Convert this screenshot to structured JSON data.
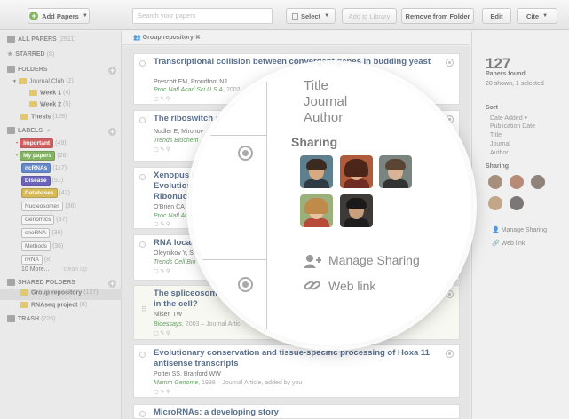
{
  "toolbar": {
    "add_papers": "Add Papers",
    "search_placeholder": "Search your papers",
    "select": "Select",
    "add_to_library": "Add to Library",
    "remove_from_folder": "Remove from Folder",
    "edit": "Edit",
    "cite": "Cite"
  },
  "sidebar": {
    "all_papers": {
      "label": "ALL PAPERS",
      "count": "(2911)"
    },
    "starred": {
      "label": "STARRED",
      "count": "(8)"
    },
    "folders": {
      "label": "FOLDERS"
    },
    "folder_items": [
      {
        "label": "Journal Club",
        "count": "(2)"
      },
      {
        "label": "Week 1",
        "count": "(4)"
      },
      {
        "label": "Week 2",
        "count": "(5)"
      },
      {
        "label": "Thesis",
        "count": "(128)"
      }
    ],
    "labels": {
      "label": "LABELS"
    },
    "label_items": [
      {
        "label": "Important",
        "count": "(49)",
        "color": "#c22b2b"
      },
      {
        "label": "My papers",
        "count": "(28)",
        "color": "#5a9a2f"
      },
      {
        "label": "ncRNAs",
        "count": "(117)",
        "color": "#2f62b8"
      },
      {
        "label": "Disease",
        "count": "(51)",
        "color": "#3b2fa8"
      },
      {
        "label": "Databases",
        "count": "(42)",
        "color": "#c9a220"
      },
      {
        "label": "Nucleosomes",
        "count": "(36)",
        "color": ""
      },
      {
        "label": "Genomics",
        "count": "(37)",
        "color": ""
      },
      {
        "label": "snoRNA",
        "count": "(36)",
        "color": ""
      },
      {
        "label": "Methods",
        "count": "(36)",
        "color": ""
      },
      {
        "label": "rRNA",
        "count": "(8)",
        "color": ""
      }
    ],
    "more": "10 More...",
    "clean_up": "clean up",
    "shared_folders": {
      "label": "SHARED FOLDERS"
    },
    "shared_items": [
      {
        "label": "Group repository",
        "count": "(127)"
      },
      {
        "label": "RNAseq project",
        "count": "(8)"
      }
    ],
    "trash": {
      "label": "TRASH",
      "count": "(226)"
    }
  },
  "breadcrumb": {
    "label": "Group repository",
    "close": "✖"
  },
  "papers": [
    {
      "title": "Transcriptional collision between convergent genes in budding yeast",
      "authors": "Prescott EM, Proudfoot NJ",
      "journal": "Proc Natl Acad Sci U S A",
      "meta": ", 2002"
    },
    {
      "title": "The riboswitch c",
      "authors": "Nudler E, Mironov",
      "journal": "Trends Biochem",
      "meta": ""
    },
    {
      "title": "Xenopus I",
      "title2": "Evolution",
      "title3": "Ribonucl",
      "authors": "O'Brien CA",
      "journal": "Proc Natl Ac",
      "meta": ""
    },
    {
      "title": "RNA local",
      "authors": "Oleynikov Y, Sing",
      "journal": "Trends Cell Bio",
      "meta": ""
    },
    {
      "title": "The spliceosom",
      "title2": "in the cell?",
      "authors": "Nilsen TW",
      "journal": "Bioessays",
      "meta": ", 2003 – Journal Artic"
    },
    {
      "title": "Evolutionary conservation and tissue-specific processing of Hoxa 11 antisense transcripts",
      "authors": "Potter SS, Branford WW",
      "journal": "Mamm Genome",
      "meta": ", 1998 – Journal Article, added by you"
    },
    {
      "title": "MicroRNAs: a developing story",
      "authors": "",
      "journal": "",
      "meta": ""
    }
  ],
  "right": {
    "count": "127",
    "found": "Papers found",
    "shown": "20 shown, 1 selected",
    "sort_label": "Sort",
    "sort_options": [
      "Date Added ▾",
      "Publication Date",
      "Title",
      "Journal",
      "Author"
    ],
    "sharing_label": "Sharing",
    "manage_sharing": "Manage Sharing",
    "web_link": "Web link"
  },
  "lens": {
    "sort_options": [
      "Title",
      "Journal",
      "Author"
    ],
    "sharing_label": "Sharing",
    "manage_sharing": "Manage Sharing",
    "web_link": "Web link"
  },
  "colors": {
    "title_blue": "#1f3e66",
    "journal_green": "#2d7d2d",
    "add_green": "#5a9a2f"
  }
}
